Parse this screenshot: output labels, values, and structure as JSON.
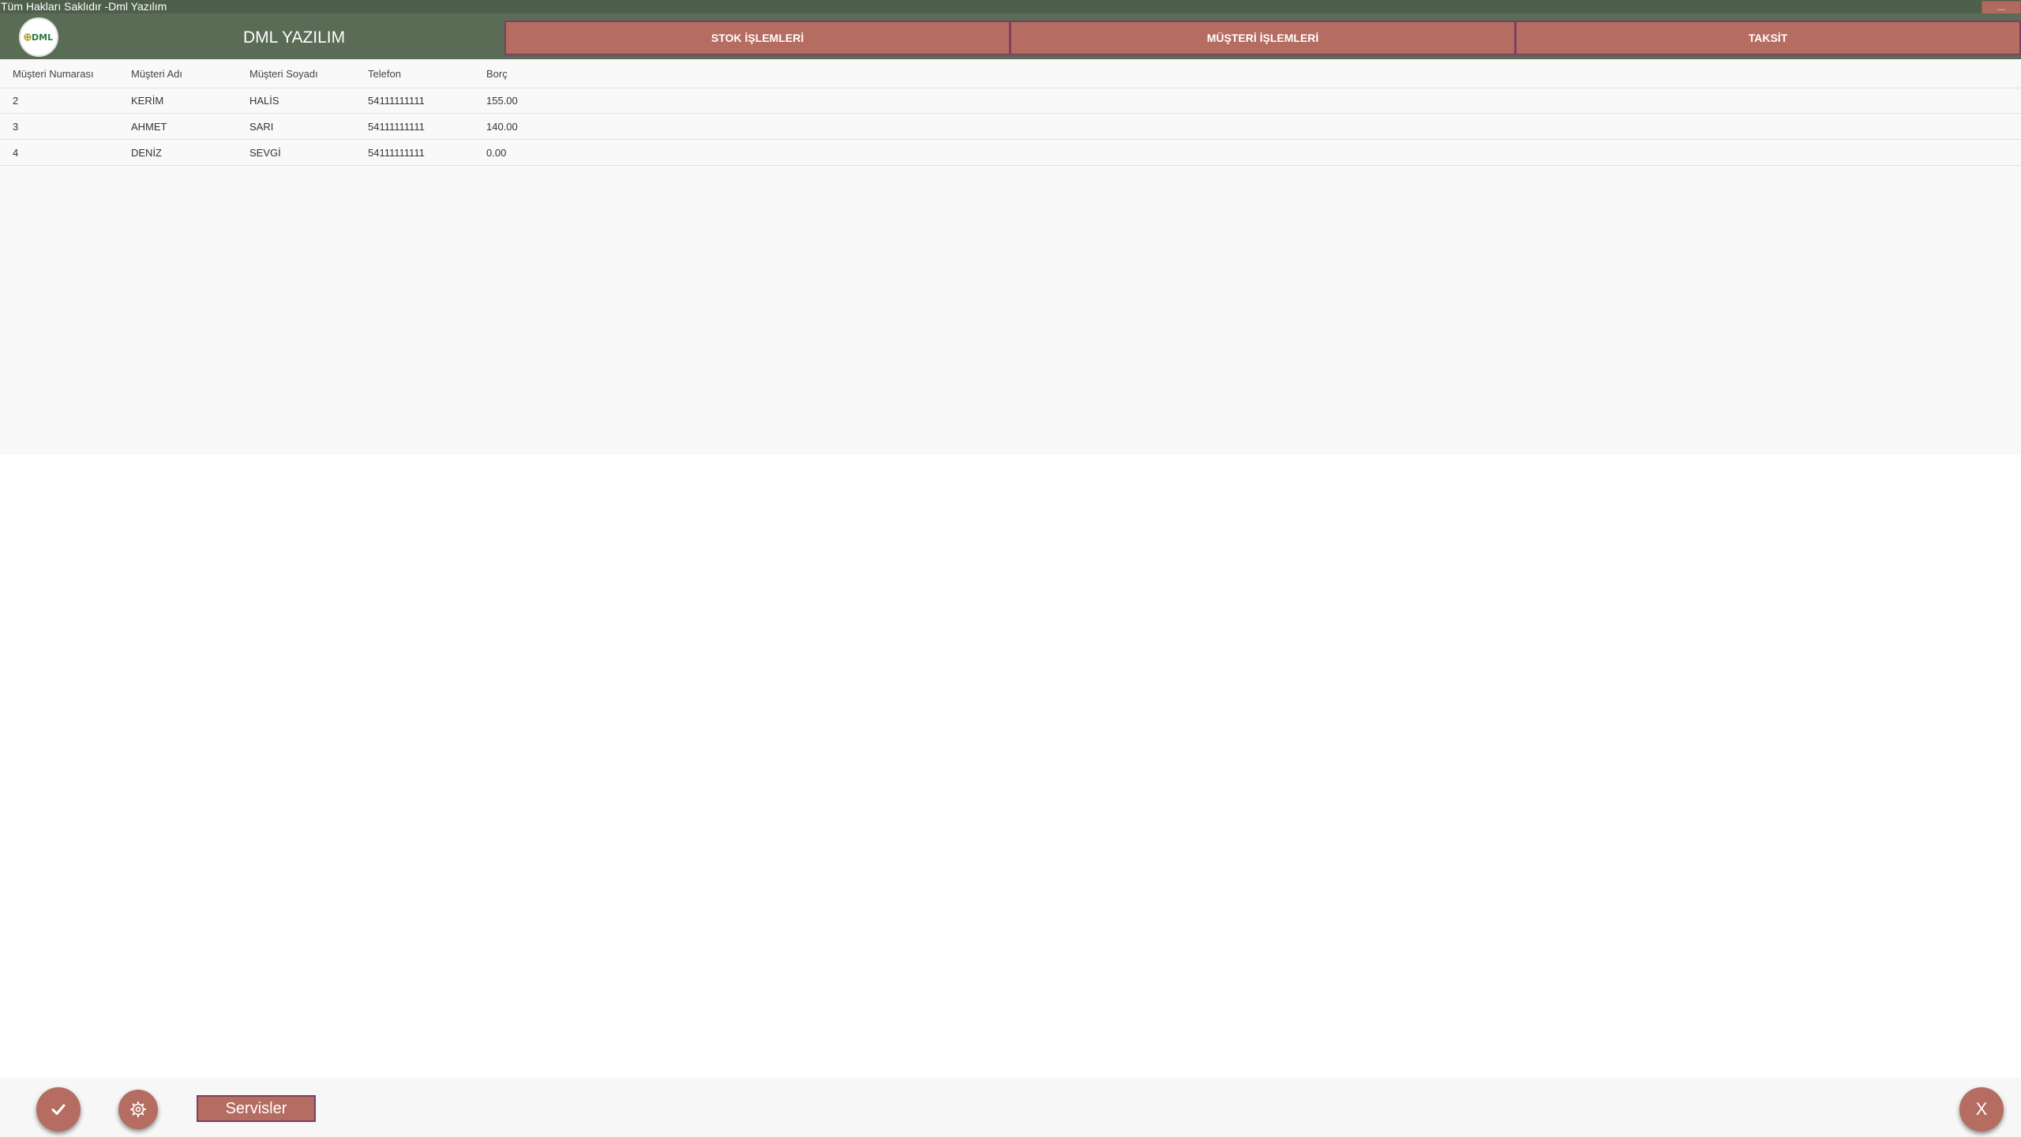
{
  "window": {
    "title": "Tüm Hakları Saklıdır -Dml Yazılım",
    "minimize_label": "..."
  },
  "header": {
    "logo_text": "DML",
    "app_name": "DML YAZILIM",
    "tabs": [
      {
        "label": "STOK İŞLEMLERİ"
      },
      {
        "label": "MÜŞTERİ İŞLEMLERİ"
      },
      {
        "label": "TAKSİT"
      }
    ]
  },
  "grid": {
    "columns": [
      "Müşteri Numarası",
      "Müşteri Adı",
      "Müşteri Soyadı",
      "Telefon",
      "Borç"
    ],
    "rows": [
      [
        "2",
        "KERİM",
        "HALİS",
        "54111111111",
        "155.00"
      ],
      [
        "3",
        "AHMET",
        "SARI",
        "54111111111",
        "140.00"
      ],
      [
        "4",
        "DENİZ",
        "SEVGİ",
        "54111111111",
        "0.00"
      ]
    ]
  },
  "footer": {
    "services_label": "Servisler",
    "close_label": "X"
  },
  "colors": {
    "header_bg": "#5a6b56",
    "titlebar_bg": "#4e5f4b",
    "accent": "#b56c61",
    "accent_border": "#7e3f62"
  },
  "icons": {
    "confirm": "check-icon",
    "settings": "gear-icon"
  }
}
